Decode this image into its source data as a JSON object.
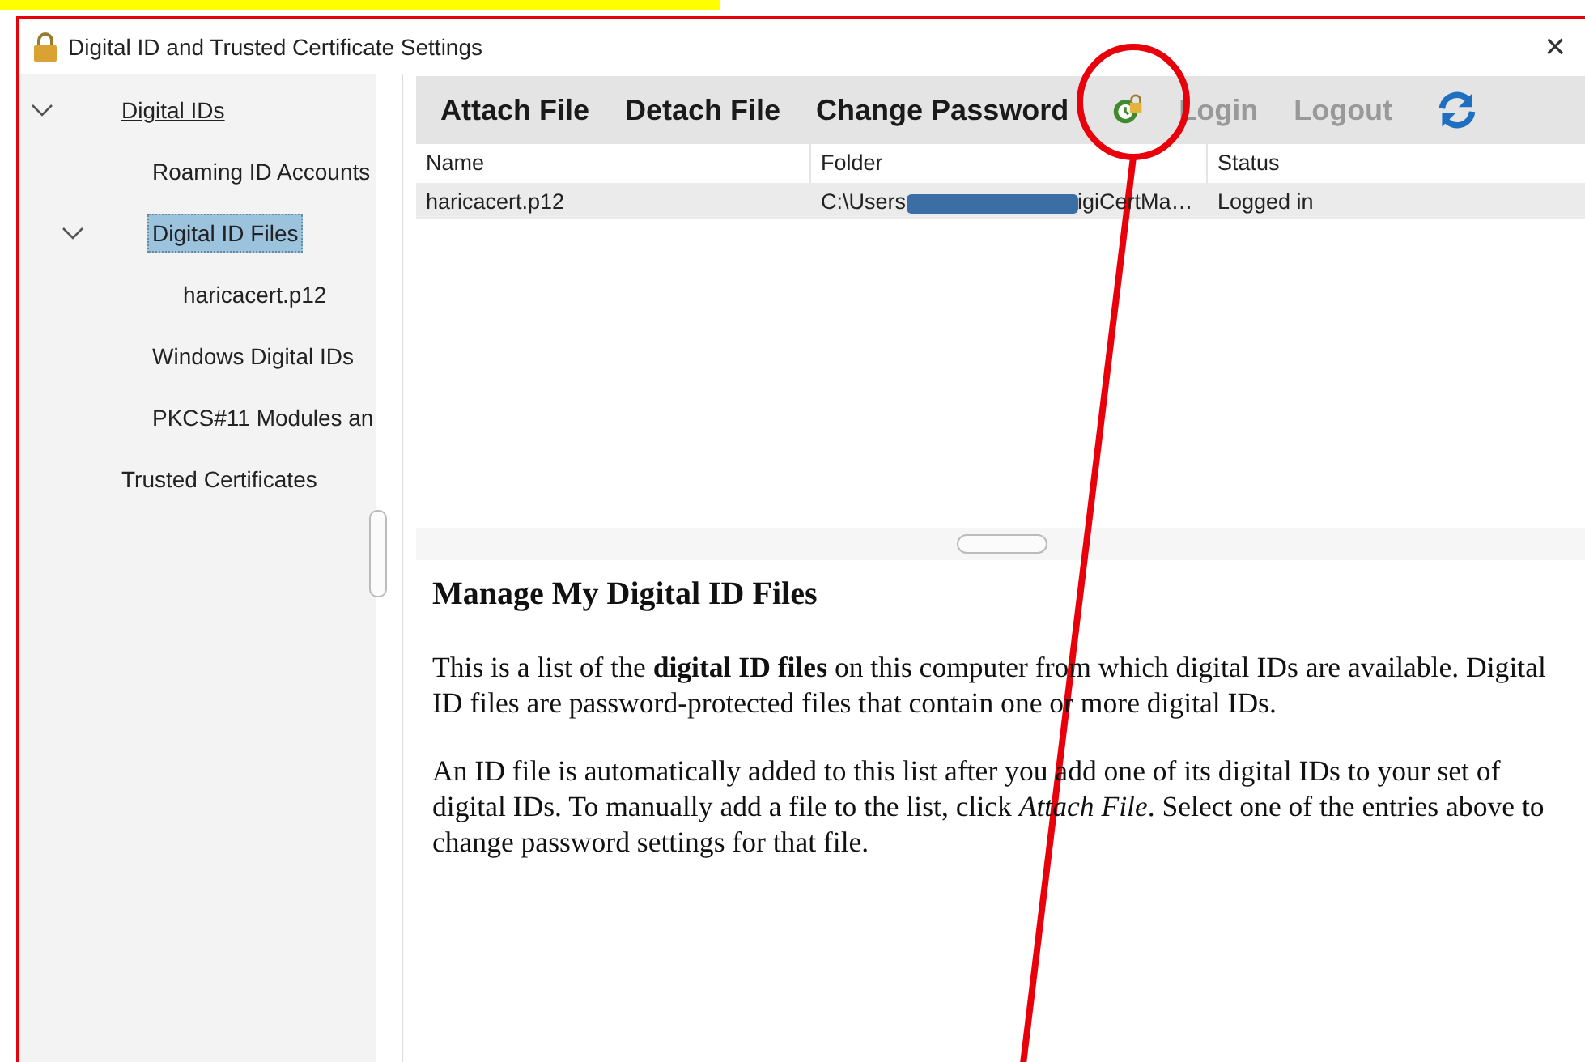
{
  "window": {
    "title": "Digital ID and Trusted Certificate Settings",
    "close": "×"
  },
  "sidebar": {
    "items": [
      {
        "label": "Digital IDs",
        "expanded": true,
        "selected": false,
        "children": [
          {
            "label": "Roaming ID Accounts",
            "selected": false
          },
          {
            "label": "Digital ID Files",
            "expanded": true,
            "selected": true,
            "children": [
              {
                "label": "haricacert.p12",
                "selected": false
              }
            ]
          },
          {
            "label": "Windows Digital IDs",
            "selected": false
          },
          {
            "label": "PKCS#11 Modules an",
            "selected": false
          }
        ]
      },
      {
        "label": "Trusted Certificates",
        "selected": false
      }
    ]
  },
  "toolbar": [
    {
      "kind": "text",
      "label": "Attach File",
      "disabled": false
    },
    {
      "kind": "text",
      "label": "Detach File",
      "disabled": false
    },
    {
      "kind": "text",
      "label": "Change Password",
      "disabled": false
    },
    {
      "kind": "seal"
    },
    {
      "kind": "text",
      "label": "Login",
      "disabled": true
    },
    {
      "kind": "text",
      "label": "Logout",
      "disabled": true
    },
    {
      "kind": "refresh"
    }
  ],
  "table": {
    "columns": [
      "Name",
      "Folder",
      "Status"
    ],
    "rows": [
      {
        "name": "haricacert.p12",
        "folder_start": "C:\\Users",
        "folder_end": "igiCertMa…",
        "status": "Logged in",
        "selected": false
      }
    ]
  },
  "help": {
    "title": "Manage My Digital ID Files",
    "paragraphs": [
      "This is a list of the **digital ID files** on this computer from which digital IDs are available. Digital ID files are password-protected files that contain one or more digital IDs.",
      "An ID file is automatically added to this list after you add one of its digital IDs to your set of digital IDs. To manually add a file to the list, click *Attach File*. Select one of the entries above to change password settings for that file."
    ]
  }
}
